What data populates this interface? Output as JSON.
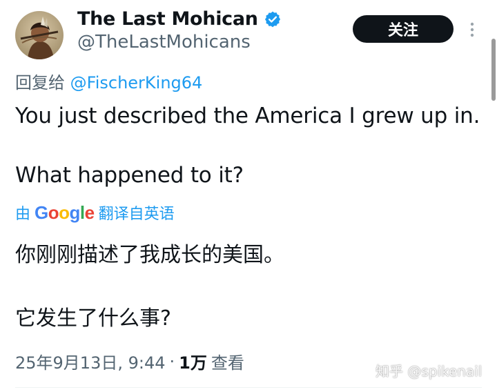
{
  "author": {
    "display_name": "The Last Mohican",
    "handle": "@TheLastMohicans",
    "verified_icon": "verified-badge-icon",
    "avatar_icon": "avatar-image"
  },
  "header": {
    "follow_label": "关注",
    "more_icon": "more-vertical-icon"
  },
  "reply": {
    "prefix": "回复给",
    "mention": "@FischerKing64"
  },
  "tweet": {
    "line1": "You just described the America I grew up in.",
    "line2": "What happened to it?"
  },
  "translation": {
    "by_label": "由",
    "provider": "Google",
    "from_label": "翻译自英语",
    "line1": "你刚刚描述了我成长的美国。",
    "line2": "它发生了什么事?"
  },
  "meta": {
    "timestamp": "25年9月13日, 9:44",
    "separator": "·",
    "views_count": "1万",
    "views_label": "查看"
  },
  "watermark": "知乎 @spikenail",
  "colors": {
    "accent": "#1d9bf0",
    "text": "#0f1419",
    "muted": "#536471",
    "button_bg": "#0f1419"
  }
}
